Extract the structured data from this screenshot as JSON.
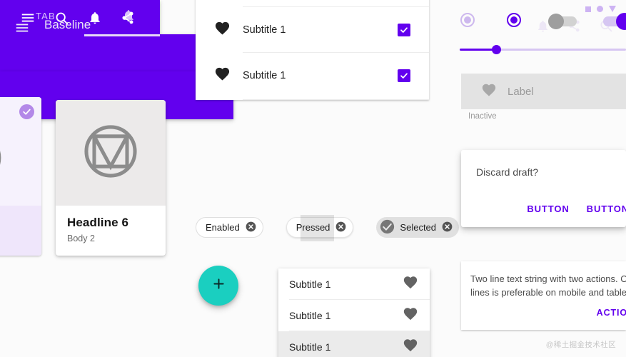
{
  "tab_bar": {
    "label": "TAB",
    "icon": "bell-icon",
    "color": "#6200EE",
    "indicator_color": "#6200EE",
    "track_color": "#e8d9f7"
  },
  "card_selected": {
    "badge_icon": "check-circle-icon",
    "badge_color": "#b388e8",
    "body_text": "",
    "background": "#f6f2fd"
  },
  "card_main": {
    "media_icon": "material-logo-icon",
    "headline": "Headline 6",
    "body": "Body 2",
    "media_bg": "#eceaea"
  },
  "bottom_app_bar": {
    "color": "#6200EE",
    "icons": [
      "menu-icon",
      "search-icon",
      "bell-icon",
      "share-icon"
    ],
    "fab": {
      "icon": "plus-icon",
      "color": "#1ACFC0"
    }
  },
  "list_top": {
    "rows": [
      {
        "leading_icon": "heart-icon",
        "text": "Subtitle 1",
        "checked": true
      },
      {
        "leading_icon": "heart-icon",
        "text": "Subtitle 1",
        "checked": true
      }
    ],
    "checkbox_color": "#6200EE"
  },
  "app_bar": {
    "title": "Baseline",
    "nav_icon": "menu-icon",
    "actions": [
      "bell-icon",
      "share-icon",
      "search-icon"
    ],
    "status_icons": [
      "square-icon",
      "circle-icon",
      "triangle-down-icon"
    ],
    "color": "#6200EE"
  },
  "chips": [
    {
      "label": "Enabled",
      "state": "enabled",
      "has_close": true,
      "has_check": false
    },
    {
      "label": "Pressed",
      "state": "pressed",
      "has_close": true,
      "has_check": false
    },
    {
      "label": "Selected",
      "state": "selected",
      "has_close": true,
      "has_check": true
    }
  ],
  "list_bottom": {
    "rows": [
      {
        "text": "Subtitle 1",
        "trailing_icon": "heart-icon",
        "highlighted": false
      },
      {
        "text": "Subtitle 1",
        "trailing_icon": "heart-icon",
        "highlighted": false
      },
      {
        "text": "Subtitle 1",
        "trailing_icon": "heart-icon",
        "highlighted": true
      }
    ]
  },
  "selection_controls": {
    "radio_inactive": {
      "selected": true,
      "color": "#cdb8ee"
    },
    "radio_active": {
      "selected": true,
      "color": "#6200EE"
    },
    "switch_off": {
      "on": false,
      "color": "#9e9e9e"
    },
    "switch_on": {
      "on": true,
      "color": "#6200EE"
    },
    "slider": {
      "value": 22,
      "color": "#6200EE",
      "track_color": "#d6c6f2"
    }
  },
  "inactive_button": {
    "icon": "heart-icon",
    "label": "Label",
    "caption": "Inactive",
    "background": "#e3e3e3",
    "text_color": "#9a9a9a"
  },
  "dialog": {
    "title": "Discard draft?",
    "buttons": [
      "BUTTON",
      "BUTTON"
    ],
    "button_color": "#6200EE"
  },
  "snackbar": {
    "line1": "Two line text string with two actions. One to two",
    "line2": "lines is preferable on mobile and tablet.",
    "action": "ACTION",
    "action_color": "#6200EE"
  },
  "watermark": {
    "text": "@稀土掘金技术社区"
  }
}
